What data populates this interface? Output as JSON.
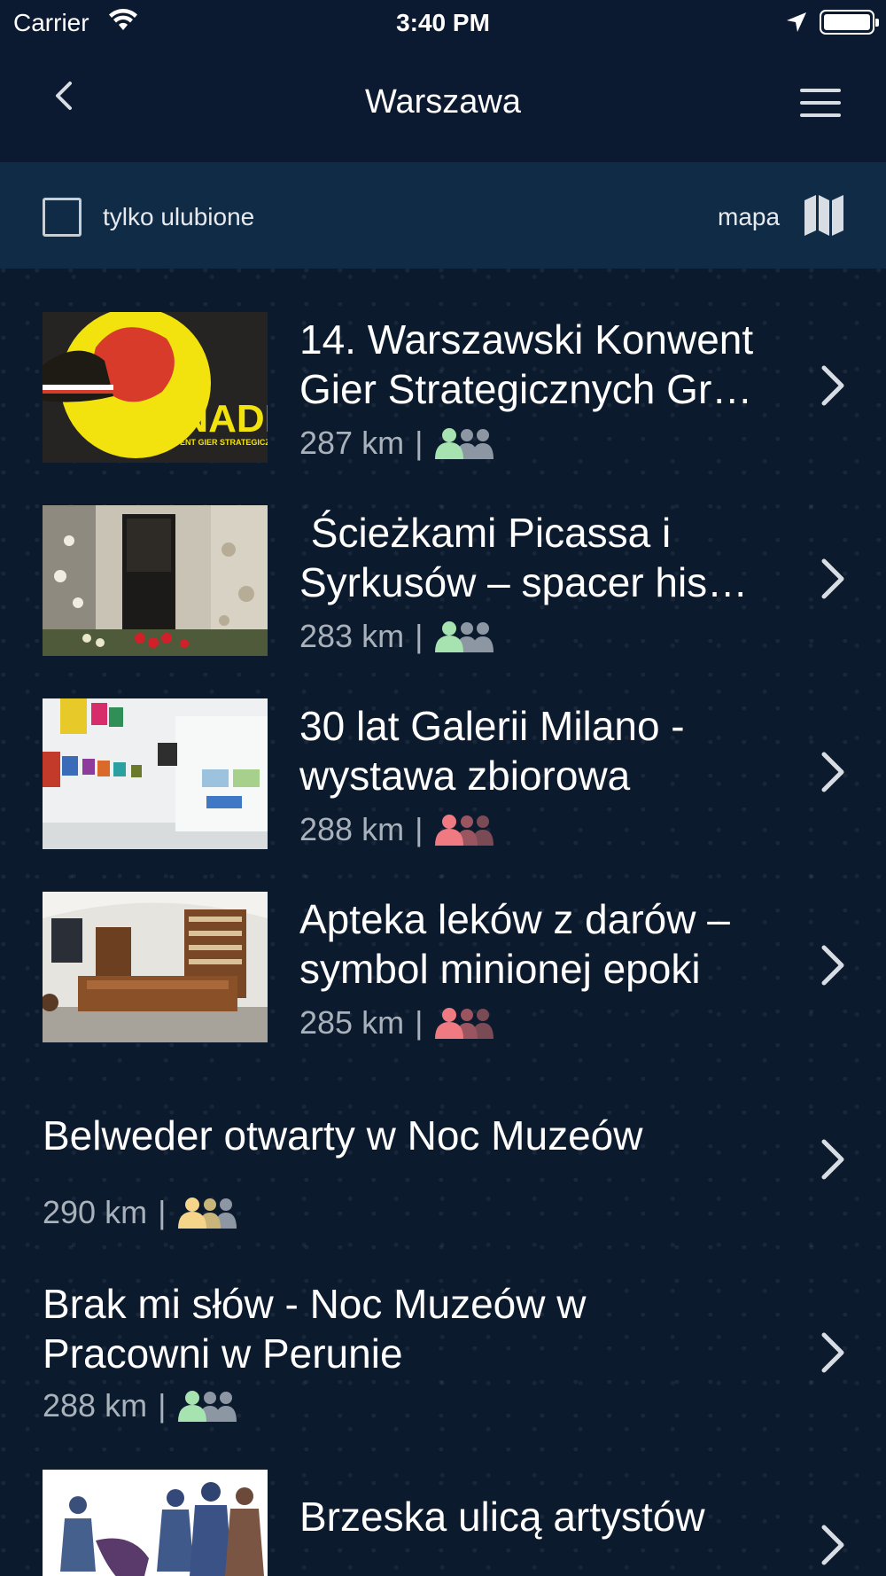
{
  "status_bar": {
    "carrier": "Carrier",
    "time": "3:40 PM"
  },
  "nav": {
    "title": "Warszawa",
    "back_icon": "chevron-left-icon",
    "menu_icon": "hamburger-menu-icon"
  },
  "filter": {
    "favorites_label": "tylko ulubione",
    "favorites_checked": false,
    "map_label": "mapa",
    "map_icon": "map-icon"
  },
  "colors": {
    "background": "#0c1a2e",
    "header": "#0b1a30",
    "filter_bar": "#0f2b45",
    "group_green": "#a6e3b0",
    "group_red": "#f07a82",
    "group_yellow": "#f5d58a",
    "group_grey": "#8d96a3"
  },
  "events": [
    {
      "title_line1": "14. Warszawski Konwent",
      "title_line2": "Gier Strategicznych Gr…",
      "distance": "287 km",
      "separator": "|",
      "audience_color": "green",
      "thumbnail": "grenadier-logo",
      "thumb_text": "GRENADIER",
      "thumb_subtext": "WARSZAWSKI KONWENT GIER STRATEGICZNYCH"
    },
    {
      "title_line1": " Ścieżkami Picassa i",
      "title_line2": "Syrkusów – spacer his…",
      "distance": "283 km",
      "separator": "|",
      "audience_color": "green",
      "thumbnail": "building-entrance-photo"
    },
    {
      "title_line1": "30 lat Galerii Milano -",
      "title_line2": "wystawa zbiorowa",
      "distance": "288 km",
      "separator": "|",
      "audience_color": "red",
      "thumbnail": "gallery-interior-photo"
    },
    {
      "title_line1": "Apteka leków z darów –",
      "title_line2": "symbol minionej epoki",
      "distance": "285 km",
      "separator": "|",
      "audience_color": "red",
      "thumbnail": "pharmacy-interior-photo"
    },
    {
      "title_line1": "Belweder otwarty w Noc Muzeów",
      "distance": "290 km",
      "separator": "|",
      "audience_color": "yellow"
    },
    {
      "title_line1": "Brak mi słów - Noc Muzeów w",
      "title_line2": "Pracowni w Perunie",
      "distance": "288 km",
      "separator": "|",
      "audience_color": "green"
    },
    {
      "title_line1": "Brzeska ulicą artystów",
      "thumbnail": "sculptures-photo"
    }
  ]
}
